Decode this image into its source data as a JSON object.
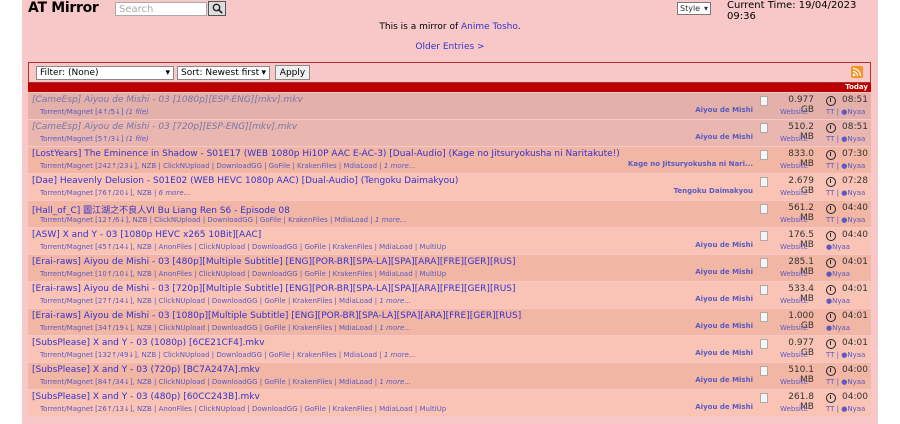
{
  "header": {
    "logo": "AT Mirror",
    "search_placeholder": "Search",
    "style_label": "Style",
    "current_time": "Current Time: 19/04/2023 09:36"
  },
  "notice": {
    "prefix": "This is a mirror of ",
    "link": "Anime Tosho",
    "suffix": "."
  },
  "older_entries": "Older Entries >",
  "filters": {
    "filter_value": "Filter: (None)",
    "sort_value": "Sort: Newest first",
    "apply_label": "Apply"
  },
  "today_label": "Today",
  "entries": [
    {
      "title": "[CameEsp] Aiyou de Mishi - 03 [1080p][ESP-ENG][mkv].mkv",
      "links": "Torrent/Magnet [4↑/5↓]",
      "extra": "(1 file)",
      "series": "Aiyou de Mishi",
      "size": "0.977 GB",
      "website": "Website",
      "time": "08:51",
      "source": "TT | ●Nyaa",
      "old": true
    },
    {
      "title": "[CameEsp] Aiyou de Mishi - 03 [720p][ESP-ENG][mkv].mkv",
      "links": "Torrent/Magnet [5↑/3↓]",
      "extra": "(1 file)",
      "series": "Aiyou de Mishi",
      "size": "510.2 MB",
      "website": "Website",
      "time": "08:51",
      "source": "TT | ●Nyaa",
      "old": true
    },
    {
      "title": "[LostYears] The Eminence in Shadow - S01E17 (WEB 1080p Hi10P AAC E-AC-3) [Dual-Audio] (Kage no Jitsuryokusha ni Naritakute!)",
      "links": "Torrent/Magnet [242↑/23↓], NZB | ClickNUpload | DownloadGG | GoFile | KrakenFiles | MdiaLoad |",
      "extra": "1 more...",
      "series": "Kage no Jitsuryokusha ni Nari...",
      "size": "833.0 MB",
      "website": "Website",
      "time": "07:30",
      "source": "TT | ●Nyaa",
      "old": false
    },
    {
      "title": "[Dae] Heavenly Delusion - S01E02 (WEB HEVC 1080p AAC) [Dual-Audio] (Tengoku Daimakyou)",
      "links": "Torrent/Magnet [76↑/20↓], NZB |",
      "extra": "6 more...",
      "series": "Tengoku Daimakyou",
      "size": "2.679 GB",
      "website": "Website",
      "time": "07:28",
      "source": "TT | ●Nyaa",
      "old": false
    },
    {
      "title": "[Hall_of_C] 圖江湖之不良人VI Bu Liang Ren S6 - Episode 08",
      "links": "Torrent/Magnet [12↑/6↓], NZB | ClickNUpload | DownloadGG | GoFile | KrakenFiles | MdiaLoad |",
      "extra": "1 more...",
      "series": "",
      "size": "561.2 MB",
      "website": "Website",
      "time": "04:40",
      "source": "TT | ●Nyaa",
      "old": false
    },
    {
      "title": "[ASW] X and Y - 03 [1080p HEVC x265 10Bit][AAC]",
      "links": "Torrent/Magnet [45↑/14↓], NZB | AnonFiles | ClickNUpload | DownloadGG | GoFile | KrakenFiles | MdiaLoad | MultiUp",
      "extra": "",
      "series": "Aiyou de Mishi",
      "size": "176.5 MB",
      "website": "Website",
      "time": "04:40",
      "source": "●Nyaa",
      "old": false
    },
    {
      "title": "[Erai-raws] Aiyou de Mishi - 03 [480p][Multiple Subtitle] [ENG][POR-BR][SPA-LA][SPA][ARA][FRE][GER][RUS]",
      "links": "Torrent/Magnet [10↑/10↓], NZB | AnonFiles | ClickNUpload | DownloadGG | GoFile | KrakenFiles | MdiaLoad | MultiUp",
      "extra": "",
      "series": "Aiyou de Mishi",
      "size": "285.1 MB",
      "website": "Website",
      "time": "04:01",
      "source": "●Nyaa",
      "old": false
    },
    {
      "title": "[Erai-raws] Aiyou de Mishi - 03 [720p][Multiple Subtitle] [ENG][POR-BR][SPA-LA][SPA][ARA][FRE][GER][RUS]",
      "links": "Torrent/Magnet [27↑/14↓], NZB | ClickNUpload | DownloadGG | GoFile | KrakenFiles | MdiaLoad |",
      "extra": "1 more...",
      "series": "Aiyou de Mishi",
      "size": "533.4 MB",
      "website": "Website",
      "time": "04:01",
      "source": "●Nyaa",
      "old": false
    },
    {
      "title": "[Erai-raws] Aiyou de Mishi - 03 [1080p][Multiple Subtitle] [ENG][POR-BR][SPA-LA][SPA][ARA][FRE][GER][RUS]",
      "links": "Torrent/Magnet [34↑/19↓], NZB | ClickNUpload | DownloadGG | GoFile | KrakenFiles | MdiaLoad |",
      "extra": "1 more...",
      "series": "Aiyou de Mishi",
      "size": "1.000 GB",
      "website": "Website",
      "time": "04:01",
      "source": "●Nyaa",
      "old": false
    },
    {
      "title": "[SubsPlease] X and Y - 03 (1080p) [6CE21CF4].mkv",
      "links": "Torrent/Magnet [132↑/49↓], NZB | ClickNUpload | DownloadGG | GoFile | KrakenFiles | MdiaLoad |",
      "extra": "1 more...",
      "series": "Aiyou de Mishi",
      "size": "0.977 GB",
      "website": "Website",
      "time": "04:01",
      "source": "TT | ●Nyaa",
      "old": false
    },
    {
      "title": "[SubsPlease] X and Y - 03 (720p) [BC7A247A].mkv",
      "links": "Torrent/Magnet [84↑/34↓], NZB | ClickNUpload | DownloadGG | GoFile | KrakenFiles | MdiaLoad |",
      "extra": "1 more...",
      "series": "Aiyou de Mishi",
      "size": "510.1 MB",
      "website": "Website",
      "time": "04:00",
      "source": "TT | ●Nyaa",
      "old": false
    },
    {
      "title": "[SubsPlease] X and Y - 03 (480p) [60CC243B].mkv",
      "links": "Torrent/Magnet [26↑/13↓], NZB | AnonFiles | ClickNUpload | DownloadGG | GoFile | KrakenFiles | MdiaLoad | MultiUp",
      "extra": "",
      "series": "Aiyou de Mishi",
      "size": "261.8 MB",
      "website": "Website",
      "time": "04:00",
      "source": "TT | ●Nyaa",
      "old": false
    }
  ]
}
